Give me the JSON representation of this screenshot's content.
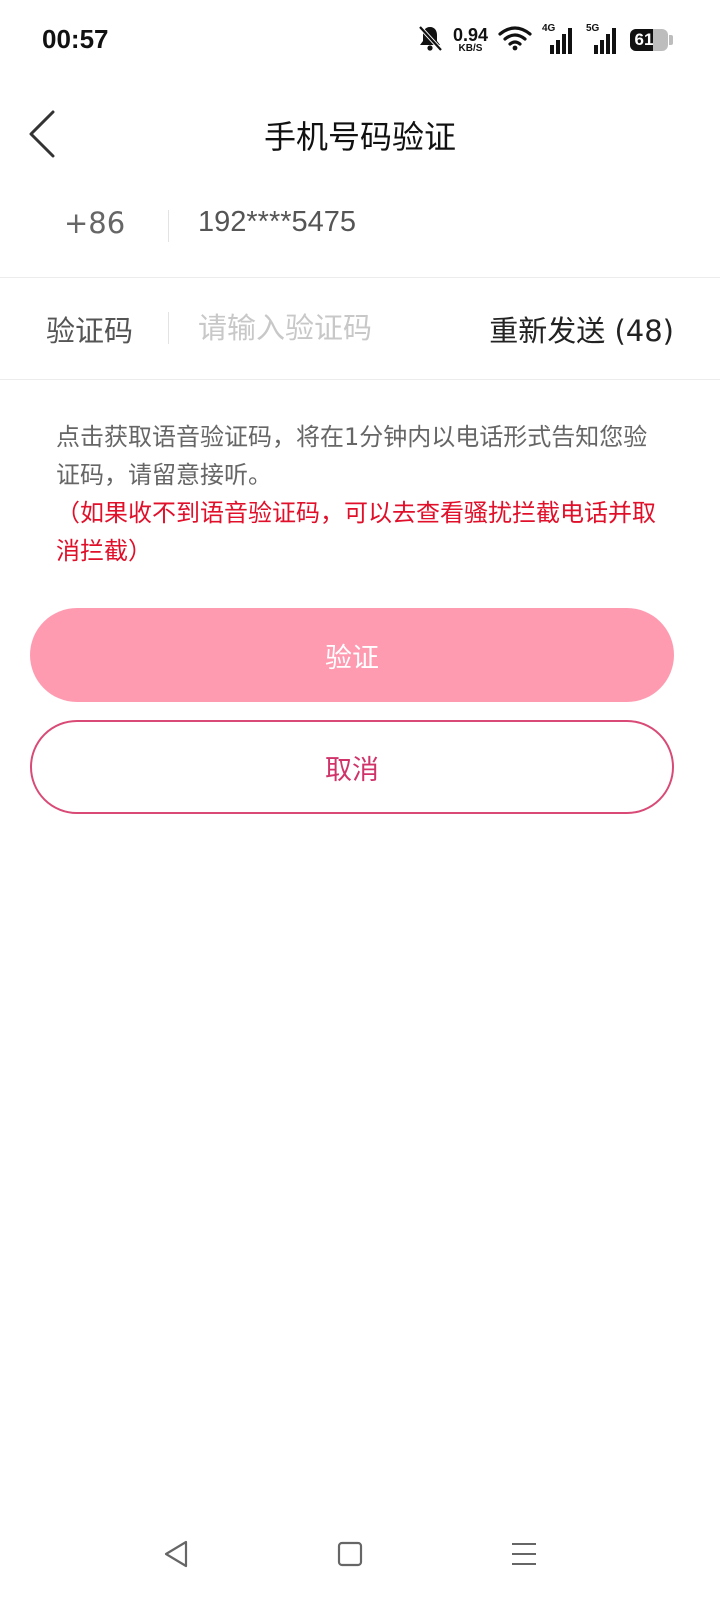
{
  "status_bar": {
    "time": "00:57",
    "net_speed_value": "0.94",
    "net_speed_unit": "KB/S",
    "sim1_tag": "4G",
    "sim2_tag": "5G",
    "battery_level": "61",
    "battery_fraction": 0.61,
    "icons": [
      "mute-bell-icon",
      "wifi-icon",
      "signal-icon",
      "battery-icon"
    ]
  },
  "nav": {
    "title": "手机号码验证",
    "back_icon": "chevron-left-icon"
  },
  "phone_row": {
    "country_code": "+86",
    "phone_number": "192****5475"
  },
  "code_row": {
    "label": "验证码",
    "placeholder": "请输入验证码",
    "value": "",
    "resend_label": "重新发送 (48)"
  },
  "notice": {
    "text": "点击获取语音验证码，将在1分钟内以电话形式告知您验证码，请留意接听。",
    "warning": "（如果收不到语音验证码，可以去查看骚扰拦截电话并取消拦截）"
  },
  "buttons": {
    "verify_label": "验证",
    "cancel_label": "取消"
  },
  "colors": {
    "accent": "#ff9bb1",
    "accent_border": "#d94a76",
    "warning": "#e0102a"
  },
  "system_nav": [
    "back-triangle-icon",
    "home-square-icon",
    "menu-lines-icon"
  ]
}
